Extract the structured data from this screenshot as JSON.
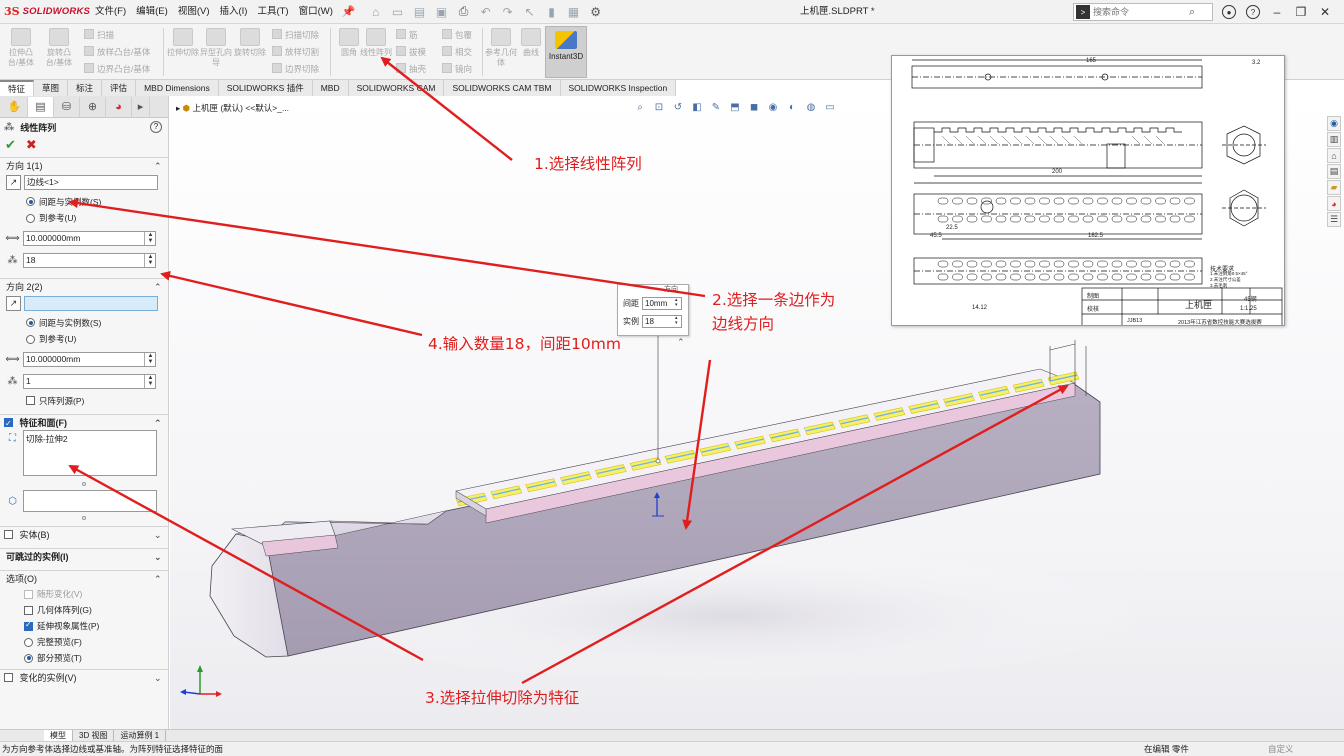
{
  "app": {
    "brand_mark": "3S",
    "brand_name": "SOLIDWORKS",
    "document_title": "上机匣.SLDPRT *",
    "menus": [
      "文件(F)",
      "编辑(E)",
      "视图(V)",
      "插入(I)",
      "工具(T)",
      "窗口(W)"
    ],
    "search_placeholder": "搜索命令",
    "colors": {
      "brand": "#c8102e",
      "accent": "#2a6bc2",
      "annotation": "#e01e1e",
      "ok": "#2a9d2a"
    }
  },
  "ribbon": {
    "big": [
      {
        "label": "拉伸凸台/基体"
      },
      {
        "label": "旋转凸台/基体"
      },
      {
        "label": "拉伸切除"
      },
      {
        "label": "异型孔向导"
      },
      {
        "label": "旋转切除"
      },
      {
        "label": "圆角"
      },
      {
        "label": "线性阵列"
      },
      {
        "label": "参考几何体"
      },
      {
        "label": "曲线"
      }
    ],
    "small": [
      "扫描",
      "放样凸台/基体",
      "边界凸台/基体",
      "扫描切除",
      "放样切割",
      "边界切除",
      "筋",
      "拔模",
      "抽壳",
      "包覆",
      "相交",
      "镜向"
    ],
    "instant3d": "Instant3D"
  },
  "command_tabs": [
    "特征",
    "草图",
    "标注",
    "评估",
    "MBD Dimensions",
    "SOLIDWORKS 插件",
    "MBD",
    "SOLIDWORKS CAM",
    "SOLIDWORKS CAM TBM",
    "SOLIDWORKS Inspection"
  ],
  "property_manager": {
    "title": "线性阵列",
    "direction1": {
      "header": "方向 1(1)",
      "edge_value": "边线<1>",
      "opt_spacing": "间距与实例数(S)",
      "opt_reference": "到参考(U)",
      "spacing": "10.000000mm",
      "instances": "18"
    },
    "direction2": {
      "header": "方向 2(2)",
      "edge_value": "",
      "opt_spacing": "间距与实例数(S)",
      "opt_reference": "到参考(U)",
      "spacing": "10.000000mm",
      "instances": "1",
      "seed_only": "只阵列源(P)"
    },
    "features": {
      "header": "特征和面(F)",
      "items": [
        "切除-拉伸2"
      ]
    },
    "bodies_header": "实体(B)",
    "skip_header": "可跳过的实例(I)",
    "options": {
      "header": "选项(O)",
      "vary_sketch": "随形变化(V)",
      "geometry_pattern": "几何体阵列(G)",
      "propagate": "延伸视象属性(P)",
      "full_preview": "完整预览(F)",
      "partial_preview": "部分预览(T)"
    },
    "varied_header": "变化的实例(V)"
  },
  "viewport": {
    "breadcrumb": "上机匣 (默认) <<默认>_...",
    "callout": {
      "title": "方向",
      "spacing_label": "间距",
      "spacing_value": "10mm",
      "instances_label": "实例",
      "instances_value": "18"
    }
  },
  "drawing": {
    "dim_total": "165",
    "dim_200": "200",
    "dim_182_5": "182.5",
    "dim_22_5": "22.5",
    "dim_45": "45.5",
    "dim_14_12": "14.12",
    "title_name": "上机匣",
    "material": "45钢",
    "scale": "1:1.25",
    "code": "JJB13",
    "school": "2013年江苏省数控技能大赛选拔赛",
    "roughness": "3.2",
    "labels_left": [
      "制图",
      "校核"
    ],
    "notes": [
      "技术要求",
      "1.未注倒角0.5×45°",
      "2.未注尺寸公差",
      "3.去毛刺"
    ]
  },
  "annotations": [
    "1.选择线性阵列",
    "2.选择一条边作为",
    "边线方向",
    "4.输入数量18，间距10mm",
    "3.选择拉伸切除为特征"
  ],
  "bottom_tabs": [
    "模型",
    "3D 视图",
    "运动算例 1"
  ],
  "status": {
    "message": "为方向参考体选择边线或基准轴。为阵列特征选择特征的面",
    "mode": "在编辑 零件",
    "custom": "自定义"
  }
}
